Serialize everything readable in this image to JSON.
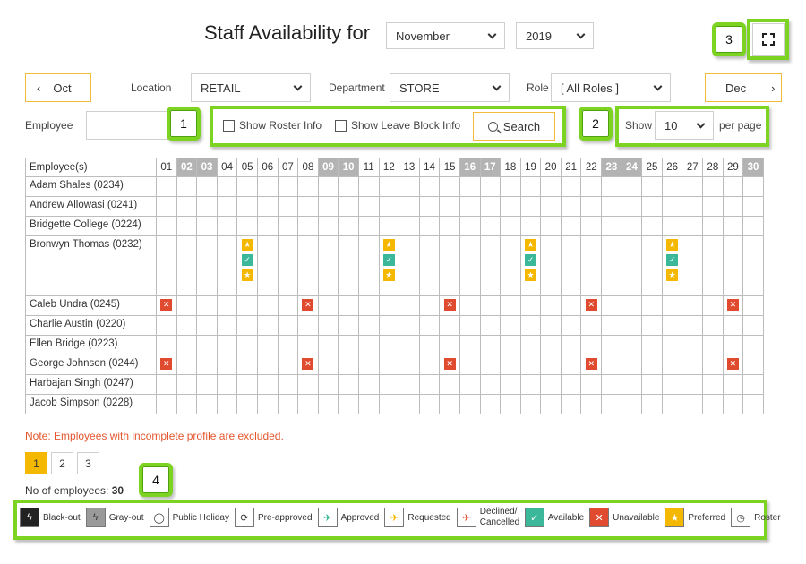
{
  "header": {
    "title": "Staff Availability for",
    "month": "November",
    "year": "2019"
  },
  "filters": {
    "prev_month": "Oct",
    "next_month": "Dec",
    "location_label": "Location",
    "location_value": "RETAIL",
    "department_label": "Department",
    "department_value": "STORE",
    "role_label": "Role",
    "role_value": "[ All Roles ]",
    "employee_label": "Employee",
    "employee_value": "",
    "show_roster": "Show Roster Info",
    "show_leave": "Show Leave Block Info",
    "search_label": "Search",
    "show_label": "Show",
    "page_size": "10",
    "per_page": "per page"
  },
  "callouts": [
    "1",
    "2",
    "3",
    "4"
  ],
  "grid": {
    "header_label": "Employee(s)",
    "days": [
      "01",
      "02",
      "03",
      "04",
      "05",
      "06",
      "07",
      "08",
      "09",
      "10",
      "11",
      "12",
      "13",
      "14",
      "15",
      "16",
      "17",
      "18",
      "19",
      "20",
      "21",
      "22",
      "23",
      "24",
      "25",
      "26",
      "27",
      "28",
      "29",
      "30"
    ],
    "weekend_days": [
      "02",
      "03",
      "09",
      "10",
      "16",
      "17",
      "23",
      "24",
      "30"
    ],
    "employees": [
      {
        "name": "Adam Shales (0234)",
        "marks": {}
      },
      {
        "name": "Andrew Allowasi (0241)",
        "marks": {}
      },
      {
        "name": "Bridgette College (0224)",
        "marks": {}
      },
      {
        "name": "Bronwyn Thomas (0232)",
        "marks": {
          "05": [
            "preferred",
            "available",
            "preferred"
          ],
          "12": [
            "preferred",
            "available",
            "preferred"
          ],
          "19": [
            "preferred",
            "available",
            "preferred"
          ],
          "26": [
            "preferred",
            "available",
            "preferred"
          ]
        }
      },
      {
        "name": "Caleb Undra (0245)",
        "marks": {
          "01": [
            "unavailable"
          ],
          "08": [
            "unavailable"
          ],
          "15": [
            "unavailable"
          ],
          "22": [
            "unavailable"
          ],
          "29": [
            "unavailable"
          ]
        }
      },
      {
        "name": "Charlie Austin (0220)",
        "marks": {}
      },
      {
        "name": "Ellen Bridge (0223)",
        "marks": {}
      },
      {
        "name": "George Johnson (0244)",
        "marks": {
          "01": [
            "unavailable"
          ],
          "08": [
            "unavailable"
          ],
          "15": [
            "unavailable"
          ],
          "22": [
            "unavailable"
          ],
          "29": [
            "unavailable"
          ]
        }
      },
      {
        "name": "Harbajan Singh (0247)",
        "marks": {}
      },
      {
        "name": "Jacob Simpson (0228)",
        "marks": {}
      }
    ]
  },
  "note": "Note: Employees with incomplete profile are excluded.",
  "pagination": {
    "pages": [
      "1",
      "2",
      "3"
    ],
    "active": "1"
  },
  "employee_count_label": "No of employees:",
  "employee_count": "30",
  "legend": [
    {
      "key": "blackout",
      "label": "Black-out",
      "icon": "bolt-icon"
    },
    {
      "key": "grayout",
      "label": "Gray-out",
      "icon": "bolt-icon"
    },
    {
      "key": "public-holiday",
      "label": "Public Holiday",
      "icon": "speech-bubble-icon"
    },
    {
      "key": "pre-approved",
      "label": "Pre-approved",
      "icon": "refresh-check-icon"
    },
    {
      "key": "approved",
      "label": "Approved",
      "icon": "plane-icon"
    },
    {
      "key": "requested",
      "label": "Requested",
      "icon": "plane-icon"
    },
    {
      "key": "declined",
      "label": "Declined/ Cancelled",
      "icon": "plane-icon"
    },
    {
      "key": "available",
      "label": "Available",
      "icon": "check-icon"
    },
    {
      "key": "unavailable",
      "label": "Unavailable",
      "icon": "cross-icon"
    },
    {
      "key": "preferred",
      "label": "Preferred",
      "icon": "star-icon"
    },
    {
      "key": "roster",
      "label": "Roster",
      "icon": "clock-icon"
    }
  ],
  "colors": {
    "accent": "#f5b800",
    "highlight": "#7cd321",
    "available": "#3bb89a",
    "unavailable": "#e04a2e",
    "weekend": "#b3b3b3",
    "note": "#e4572e"
  }
}
